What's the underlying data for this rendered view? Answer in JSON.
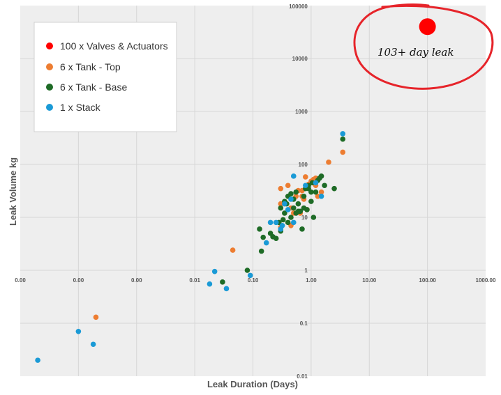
{
  "chart_data": {
    "type": "scatter",
    "xlabel": "Leak Duration (Days)",
    "ylabel": "Leak Volume kg",
    "xscale": "log",
    "yscale": "log",
    "xlim": [
      1e-05,
      1000
    ],
    "ylim": [
      0.01,
      100000
    ],
    "x_tick_labels": [
      "0.00",
      "0.00",
      "0.00",
      "0.01",
      "0.10",
      "1.00",
      "10.00",
      "100.00",
      "1000.00"
    ],
    "y_tick_labels": [
      "0.01",
      "0.1",
      "1",
      "10",
      "100",
      "1000",
      "10000",
      "100000"
    ],
    "grid": true,
    "legend_position": "top-left",
    "series": [
      {
        "name": "100 x Valves & Actuators",
        "color": "#ff0000",
        "points": [
          [
            100,
            40000
          ]
        ]
      },
      {
        "name": "6 x Tank - Top",
        "color": "#ed7d31",
        "points": [
          [
            0.0002,
            0.13
          ],
          [
            0.045,
            2.4
          ],
          [
            0.3,
            35
          ],
          [
            0.35,
            18
          ],
          [
            0.4,
            40
          ],
          [
            0.45,
            15
          ],
          [
            0.55,
            25
          ],
          [
            0.6,
            32
          ],
          [
            0.7,
            25
          ],
          [
            0.75,
            22
          ],
          [
            0.8,
            58
          ],
          [
            0.9,
            42
          ],
          [
            1.0,
            48
          ],
          [
            1.1,
            52
          ],
          [
            1.2,
            40
          ],
          [
            1.3,
            25
          ],
          [
            0.85,
            14
          ],
          [
            0.65,
            12
          ],
          [
            0.5,
            12
          ],
          [
            0.3,
            6.5
          ],
          [
            0.45,
            7
          ],
          [
            1.5,
            30
          ],
          [
            2.0,
            110
          ],
          [
            3.5,
            170
          ],
          [
            1.2,
            55
          ],
          [
            0.7,
            32
          ],
          [
            0.3,
            18
          ]
        ]
      },
      {
        "name": "6 x Tank - Base",
        "color": "#1e6b26",
        "points": [
          [
            0.03,
            0.6
          ],
          [
            0.08,
            1.0
          ],
          [
            0.13,
            6
          ],
          [
            0.14,
            2.3
          ],
          [
            0.15,
            4.2
          ],
          [
            0.2,
            5
          ],
          [
            0.22,
            4.3
          ],
          [
            0.25,
            4
          ],
          [
            0.3,
            5.5
          ],
          [
            0.33,
            9
          ],
          [
            0.35,
            20
          ],
          [
            0.4,
            25
          ],
          [
            0.45,
            10
          ],
          [
            0.5,
            15
          ],
          [
            0.55,
            12
          ],
          [
            0.6,
            18
          ],
          [
            0.65,
            13
          ],
          [
            0.7,
            6
          ],
          [
            0.75,
            15
          ],
          [
            0.8,
            35
          ],
          [
            0.9,
            40
          ],
          [
            1.0,
            20
          ],
          [
            1.05,
            45
          ],
          [
            1.1,
            10
          ],
          [
            1.2,
            30
          ],
          [
            1.3,
            50
          ],
          [
            1.5,
            60
          ],
          [
            1.7,
            40
          ],
          [
            2.5,
            35
          ],
          [
            3.5,
            300
          ],
          [
            0.4,
            8
          ],
          [
            0.35,
            12
          ],
          [
            0.5,
            22
          ],
          [
            0.6,
            13
          ],
          [
            0.3,
            15
          ],
          [
            0.28,
            8
          ],
          [
            0.38,
            18
          ],
          [
            0.45,
            28
          ],
          [
            0.9,
            35
          ],
          [
            1.4,
            55
          ],
          [
            0.55,
            30
          ],
          [
            0.85,
            14
          ],
          [
            0.75,
            25
          ],
          [
            1.0,
            30
          ]
        ]
      },
      {
        "name": "1 x Stack",
        "color": "#1a9ad6",
        "points": [
          [
            2e-05,
            0.02
          ],
          [
            0.0001,
            0.07
          ],
          [
            0.00018,
            0.04
          ],
          [
            0.018,
            0.55
          ],
          [
            0.022,
            0.95
          ],
          [
            0.035,
            0.45
          ],
          [
            0.09,
            0.8
          ],
          [
            0.17,
            3.3
          ],
          [
            0.2,
            8
          ],
          [
            0.25,
            8
          ],
          [
            0.3,
            6
          ],
          [
            0.32,
            7
          ],
          [
            0.35,
            18
          ],
          [
            0.4,
            14
          ],
          [
            0.45,
            22
          ],
          [
            0.5,
            60
          ],
          [
            0.5,
            8
          ],
          [
            0.8,
            40
          ],
          [
            1.2,
            45
          ],
          [
            1.5,
            25
          ],
          [
            3.5,
            380
          ]
        ]
      }
    ],
    "annotation": {
      "text": "103+ day leak"
    }
  }
}
